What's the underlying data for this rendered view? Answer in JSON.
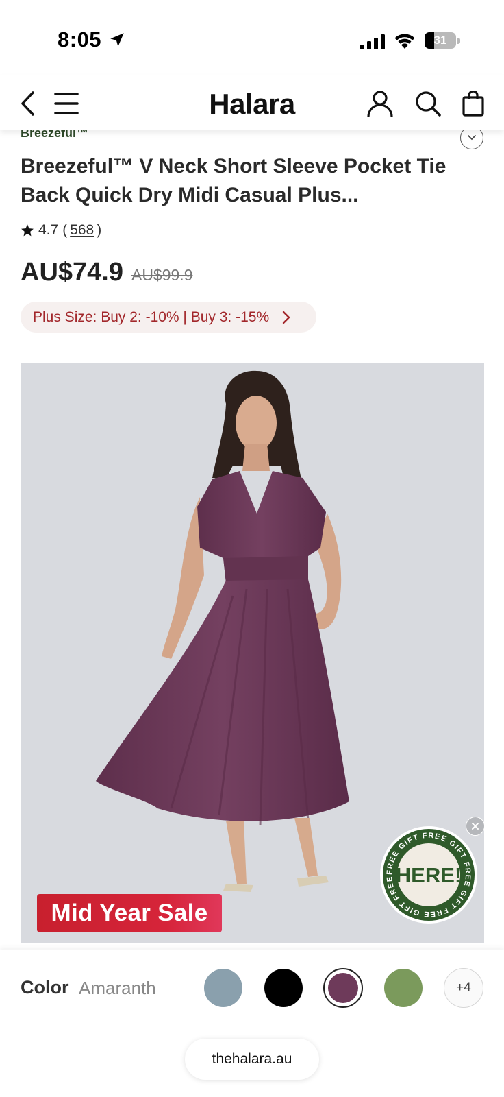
{
  "status_bar": {
    "time": "8:05",
    "battery_level": "31",
    "battery_percent": 31
  },
  "header": {
    "brand": "Halara",
    "icons": [
      "back-icon",
      "menu-icon",
      "account-icon",
      "search-icon",
      "bag-icon"
    ]
  },
  "product": {
    "brand_line": "Breezeful™",
    "title": "Breezeful™ V Neck Short Sleeve Pocket Tie Back Quick Dry Midi Casual Plus...",
    "rating": "4.7",
    "rating_count": "568",
    "price": "AU$74.9",
    "original_price": "AU$99.9",
    "promo": "Plus Size: Buy 2: -10% | Buy 3: -15%"
  },
  "image": {
    "sale_tag": "Mid Year Sale",
    "gift_badge_main": "HERE!",
    "gift_badge_ring": "FREE GIFT FREE GIFT FREE GIFT FREE GIFT FREE GIFT"
  },
  "color": {
    "label": "Color",
    "selected": "Amaranth",
    "swatches": [
      {
        "name": "blue-gray",
        "color": "#8aa0ad"
      },
      {
        "name": "black",
        "color": "#000000"
      },
      {
        "name": "amaranth",
        "color": "#6e3a5a",
        "selected": true
      },
      {
        "name": "sage-green",
        "color": "#7b9a5c"
      }
    ],
    "more": "+4"
  },
  "browser": {
    "url": "thehalara.au"
  },
  "colors": {
    "promo_text": "#a2272b",
    "promo_bg": "#f6f0ef",
    "sale_red": "#c8202e",
    "gift_green": "#2f5a2a",
    "dress": "#6e3a5a"
  }
}
